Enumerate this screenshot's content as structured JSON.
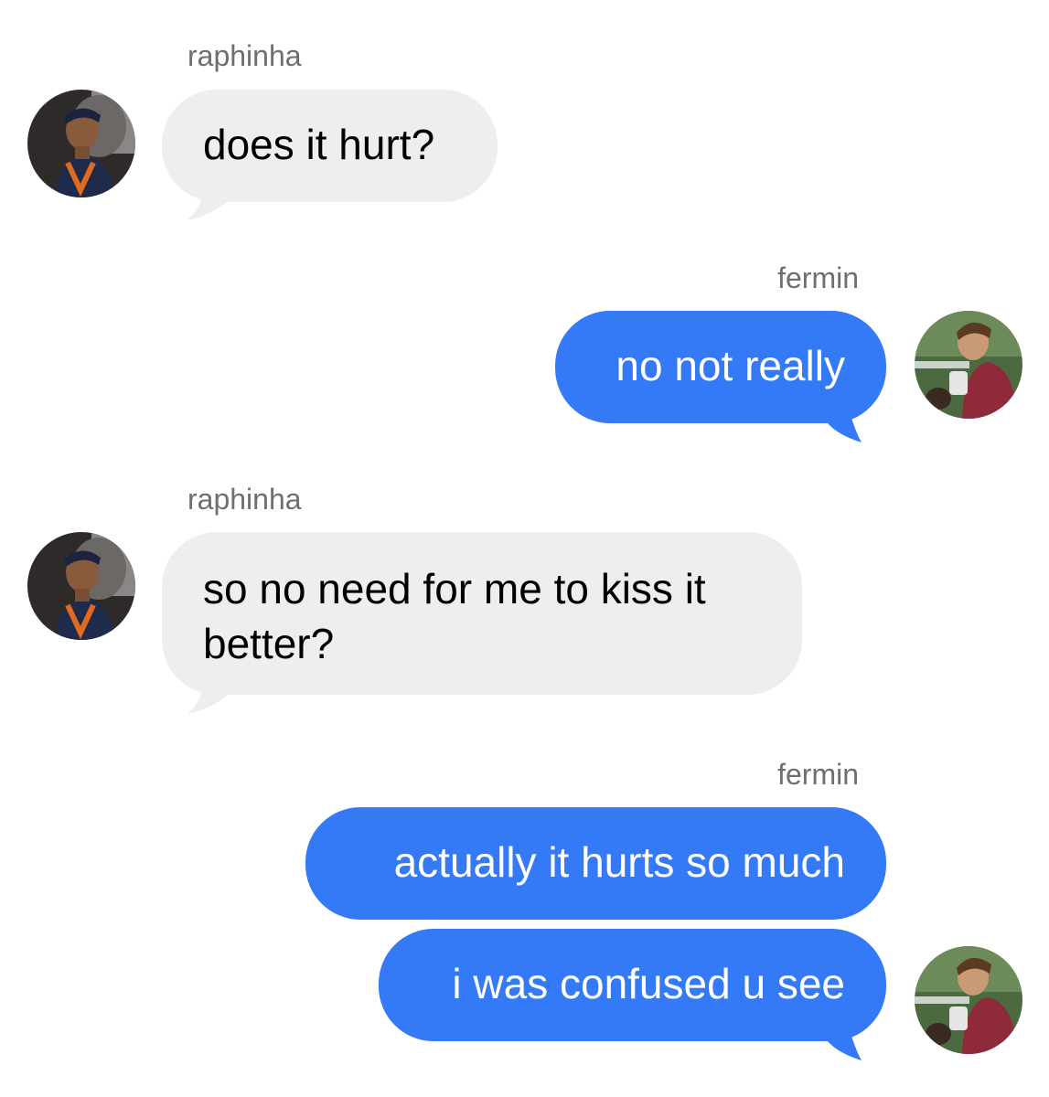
{
  "conversation": {
    "colors": {
      "incoming_bubble": "#eeeef0",
      "outgoing_bubble": "#3479f5",
      "sender_label": "#6e6e73"
    },
    "participants": {
      "left": {
        "name": "raphinha",
        "avatar_icon": "person-photo-icon"
      },
      "right": {
        "name": "fermin",
        "avatar_icon": "person-photo-icon"
      }
    },
    "messages": [
      {
        "sender": "raphinha",
        "text": "does it hurt?"
      },
      {
        "sender": "fermin",
        "text": "no not really"
      },
      {
        "sender": "raphinha",
        "text": "so no need for me to kiss it better?"
      },
      {
        "sender": "fermin",
        "text": "actually it hurts so much"
      },
      {
        "sender": "fermin",
        "text": "i was confused u see"
      }
    ]
  }
}
